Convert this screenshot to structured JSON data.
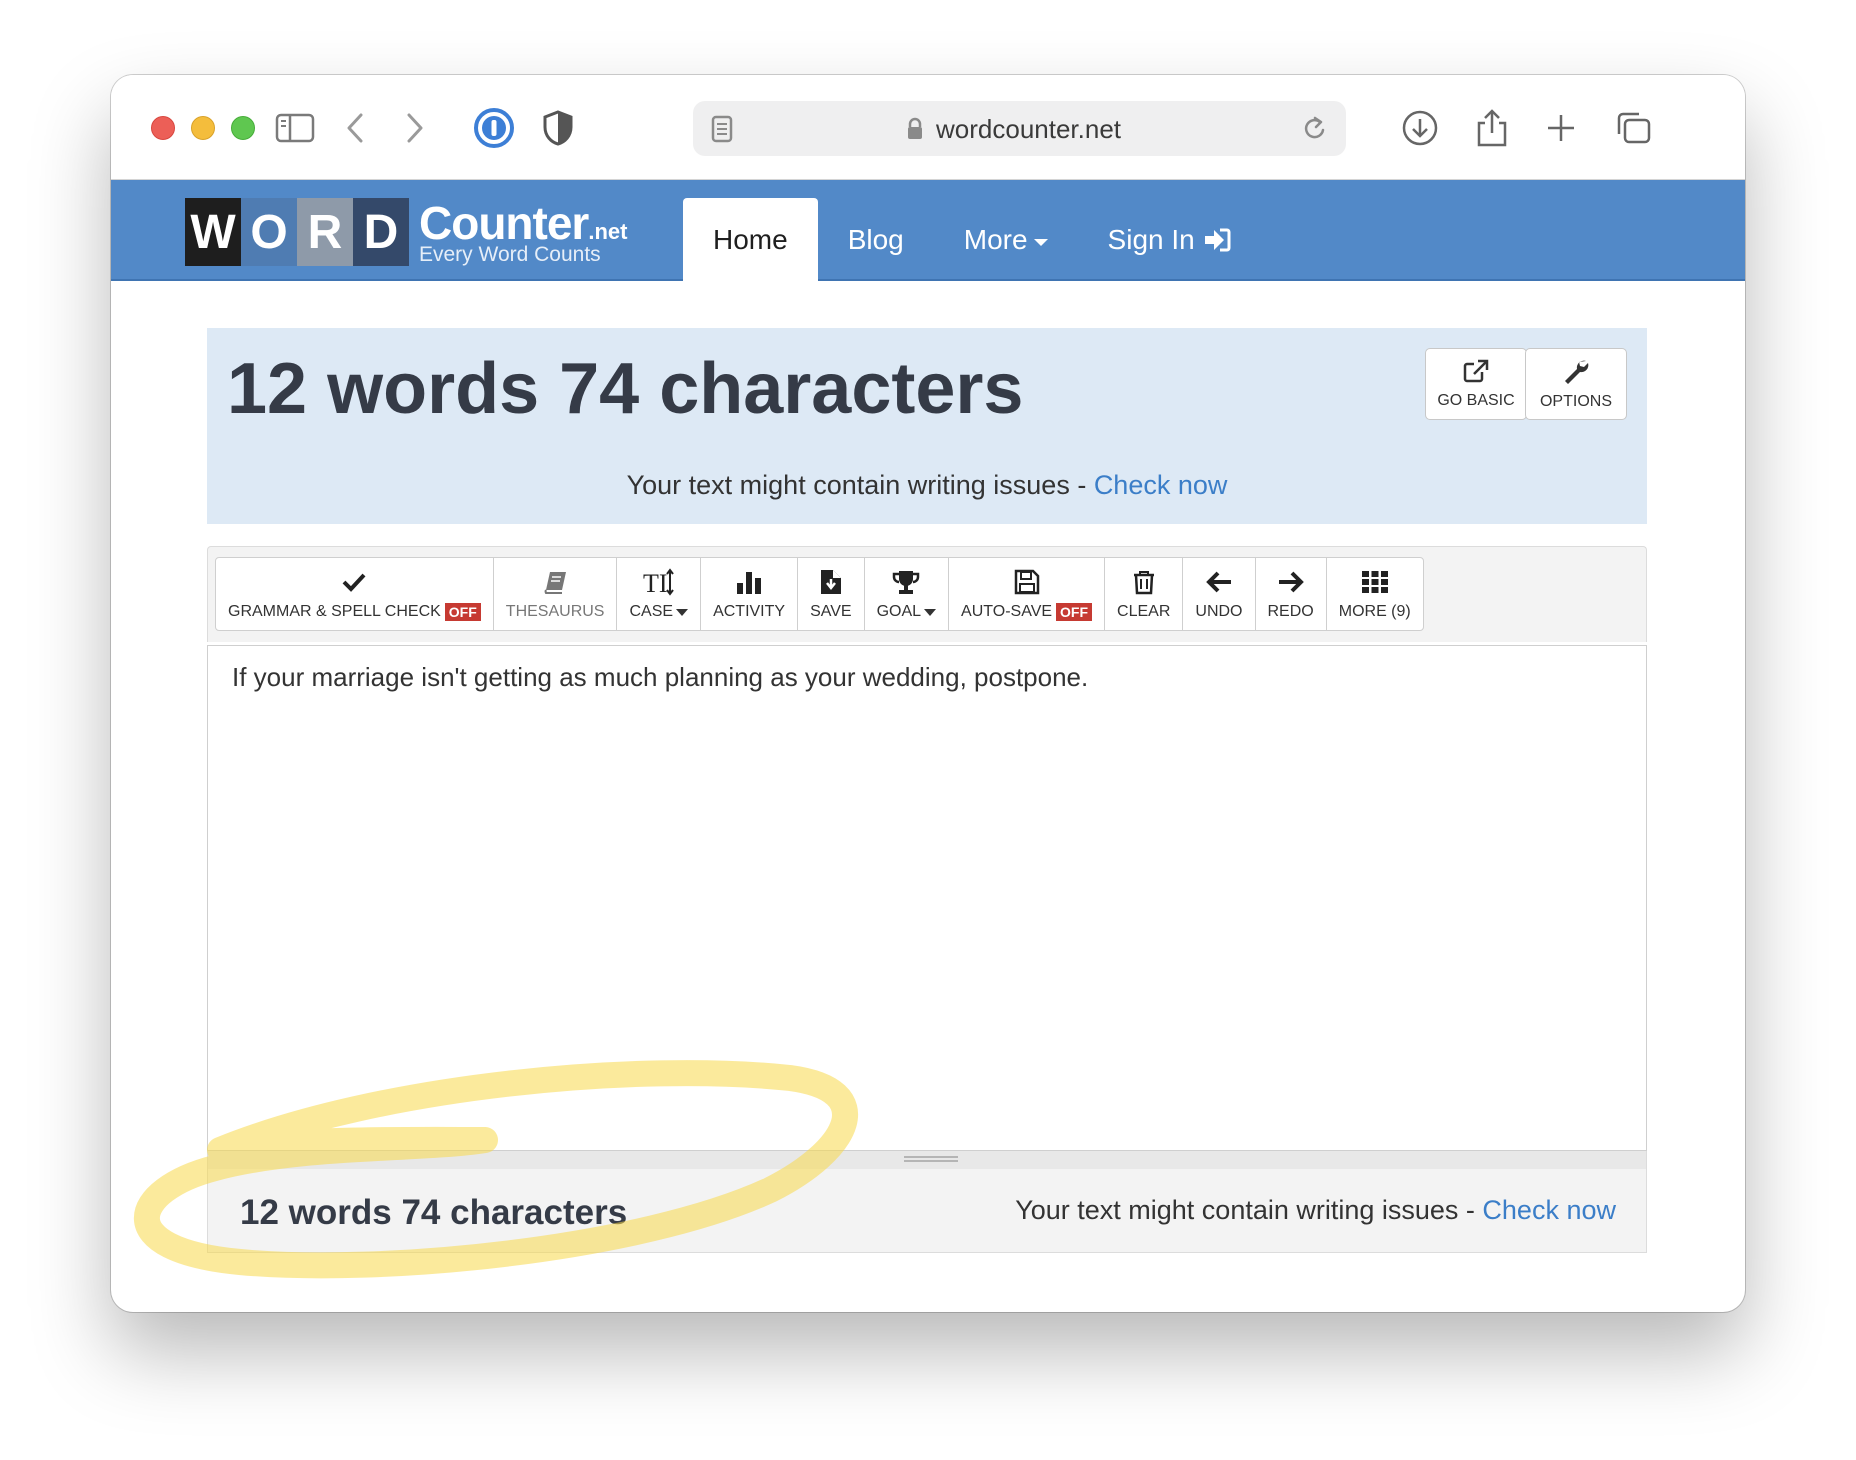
{
  "browser": {
    "url": "wordcounter.net"
  },
  "nav": {
    "logo_letters": [
      "W",
      "O",
      "R",
      "D"
    ],
    "logo_brand": "Counter",
    "logo_net": ".net",
    "logo_tagline": "Every Word Counts",
    "items": [
      {
        "label": "Home",
        "active": true
      },
      {
        "label": "Blog"
      },
      {
        "label": "More"
      },
      {
        "label": "Sign In"
      }
    ]
  },
  "counter": {
    "title": "12 words 74 characters",
    "issues_text": "Your text might contain writing issues - ",
    "issues_link": "Check now",
    "go_basic": "GO BASIC",
    "options": "OPTIONS"
  },
  "toolbar": {
    "grammar": "GRAMMAR & SPELL CHECK",
    "grammar_state": "OFF",
    "thesaurus": "THESAURUS",
    "case": "CASE",
    "activity": "ACTIVITY",
    "save": "SAVE",
    "goal": "GOAL",
    "autosave": "AUTO-SAVE",
    "autosave_state": "OFF",
    "clear": "CLEAR",
    "undo": "UNDO",
    "redo": "REDO",
    "more": "MORE (9)"
  },
  "editor": {
    "text": "If your marriage isn't getting as much planning as your wedding, postpone."
  },
  "footer": {
    "count": "12 words 74 characters",
    "issues_text": "Your text might contain writing issues - ",
    "issues_link": "Check now"
  },
  "colors": {
    "nav_bg": "#5289c8",
    "counter_bg": "#dde9f5",
    "link": "#3b7ec8",
    "off_badge": "#c63a32",
    "highlight": "#f7d84a"
  }
}
